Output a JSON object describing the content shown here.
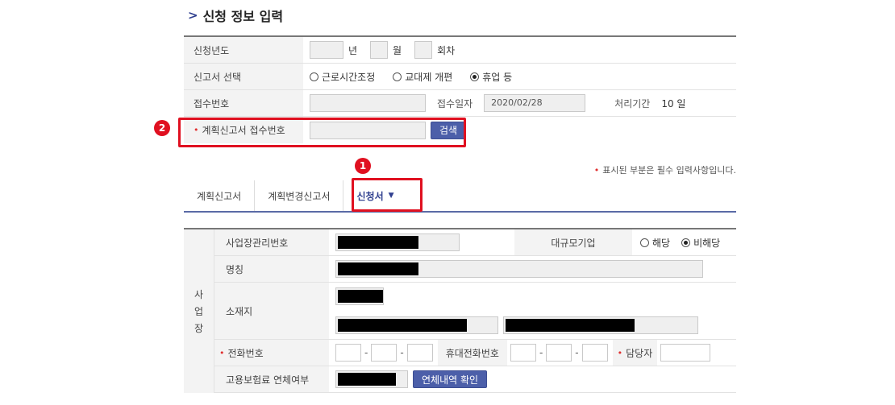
{
  "page": {
    "title": "신청 정보 입력",
    "required_note": "표시된 부분은 필수 입력사항입니다."
  },
  "form": {
    "year_label": "신청년도",
    "unit_year": "년",
    "unit_month": "월",
    "unit_round": "회차",
    "report_label": "신고서 선택",
    "report_options": [
      "근로시간조정",
      "교대제 개편",
      "휴업 등"
    ],
    "report_selected": "휴업 등",
    "receipt_no_label": "접수번호",
    "receipt_date_label": "접수일자",
    "receipt_date_value": "2020/02/28",
    "process_period_label": "처리기간",
    "process_period_value": "10 일",
    "plan_receipt_label": "계획신고서 접수번호",
    "search_button": "검색"
  },
  "badges": {
    "one": "1",
    "two": "2"
  },
  "tabs": [
    {
      "label": "계획신고서"
    },
    {
      "label": "계획변경신고서"
    },
    {
      "label": "신청서"
    }
  ],
  "business": {
    "side_label_1": "사",
    "side_label_2": "업",
    "side_label_3": "장",
    "mgmt_no_label": "사업장관리번호",
    "large_company_label": "대규모기업",
    "large_options": [
      "해당",
      "비해당"
    ],
    "large_selected": "비해당",
    "name_label": "명칭",
    "address_label": "소재지",
    "phone_label": "전화번호",
    "mobile_label": "휴대전화번호",
    "manager_label": "담당자",
    "insurance_label": "고용보험료 연체여부",
    "overdue_button": "연체내역 확인"
  },
  "colors": {
    "accent": "#4c5fa9",
    "highlight": "#e01020"
  }
}
